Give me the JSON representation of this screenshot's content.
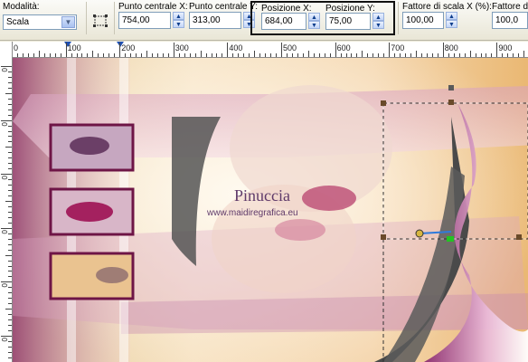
{
  "toolbar": {
    "mode": {
      "label": "Modalità:",
      "value": "Scala"
    },
    "center_x": {
      "label": "Punto centrale X:",
      "value": "754,00"
    },
    "center_y": {
      "label": "Punto centrale Y:",
      "value": "313,00"
    },
    "pos_x": {
      "label": "Posizione X:",
      "value": "684,00"
    },
    "pos_y": {
      "label": "Posizione Y:",
      "value": "75,00"
    },
    "scale_x": {
      "label": "Fattore di scala X (%):",
      "value": "100,00"
    },
    "scale_y": {
      "label": "Fattore d",
      "value": "100,0"
    }
  },
  "ruler": {
    "h_labels": [
      "0",
      "100",
      "200",
      "300",
      "400",
      "500",
      "600",
      "700",
      "800",
      "900"
    ],
    "v_labels": [
      "0",
      "0",
      "0",
      "0",
      "0",
      "0",
      "0"
    ]
  },
  "canvas": {
    "watermark_name": "Pinuccia",
    "watermark_url": "www.maidiregrafica.eu"
  },
  "colors": {
    "accent_purple": "#7a1d55",
    "handle_green": "#22c422",
    "highlight_border": "#111111"
  }
}
